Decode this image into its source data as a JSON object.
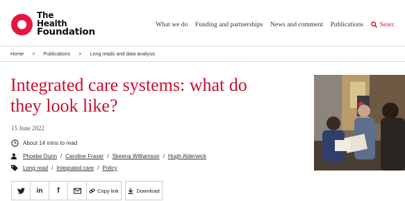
{
  "brand": {
    "line1": "The",
    "line2": "Health",
    "line3": "Foundation",
    "accent": "#c8102e",
    "logo_color": "#e5173f"
  },
  "nav": {
    "items": [
      "What we do",
      "Funding and partnerships",
      "News and comment",
      "Publications"
    ],
    "search_label": "Searc"
  },
  "breadcrumb": {
    "items": [
      "Home",
      "Publications",
      "Long reads and data analysis"
    ],
    "separator": ">"
  },
  "article": {
    "title": "Integrated care systems: what do they look like?",
    "date": "15 June 2022",
    "read_time": "About 14 mins to read",
    "authors": [
      "Phoebe Dunn",
      "Caroline Fraser",
      "Skeena Williamson",
      "Hugh Alderwick"
    ],
    "tags": [
      "Long read",
      "Integrated care",
      "Policy"
    ],
    "separator": "/"
  },
  "share": {
    "icons": [
      "twitter-icon",
      "linkedin-icon",
      "facebook-icon",
      "email-icon"
    ],
    "twitter": "y",
    "linkedin": "in",
    "facebook": "f",
    "copy_label": "Copy link",
    "download_label": "Download"
  }
}
